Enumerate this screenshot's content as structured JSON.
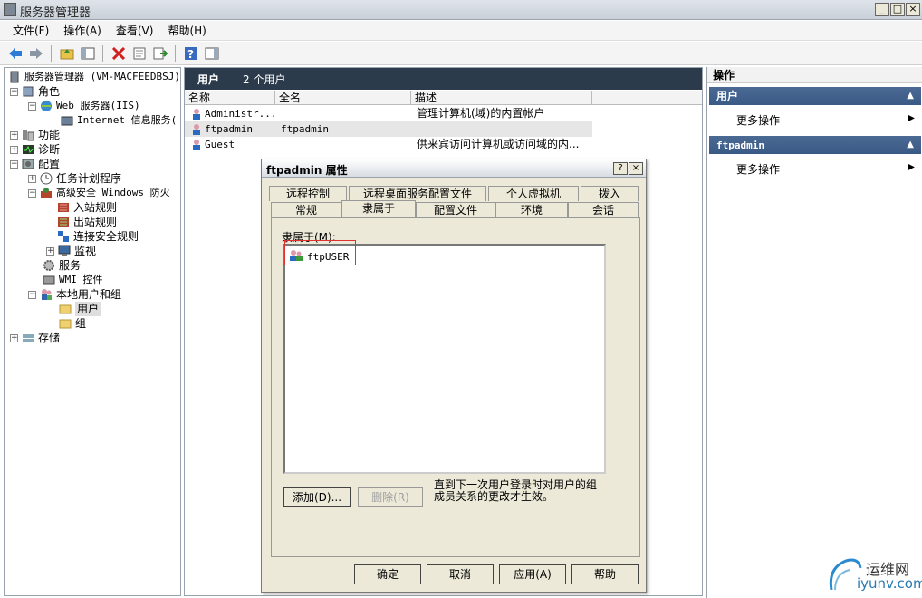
{
  "window": {
    "title": "服务器管理器"
  },
  "window_buttons": [
    "_",
    "□",
    "×"
  ],
  "menu": [
    "文件(F)",
    "操作(A)",
    "查看(V)",
    "帮助(H)"
  ],
  "tree": [
    {
      "label": "服务器管理器 (VM-MACFEEDBSJ)",
      "icon": "server-manager-icon"
    },
    {
      "label": "角色",
      "expander": "−",
      "icon": "roles-icon"
    },
    {
      "label": "Web 服务器(IIS)",
      "expander": "−",
      "icon": "web-server-icon"
    },
    {
      "label": "Internet 信息服务(",
      "icon": "iis-icon"
    },
    {
      "label": "功能",
      "expander": "+",
      "icon": "features-icon"
    },
    {
      "label": "诊断",
      "expander": "+",
      "icon": "diagnostics-icon"
    },
    {
      "label": "配置",
      "expander": "−",
      "icon": "configuration-icon"
    },
    {
      "label": "任务计划程序",
      "expander": "+",
      "icon": "task-scheduler-icon"
    },
    {
      "label": "高级安全 Windows 防火",
      "expander": "−",
      "icon": "firewall-icon"
    },
    {
      "label": "入站规则",
      "icon": "inbound-rules-icon"
    },
    {
      "label": "出站规则",
      "icon": "outbound-rules-icon"
    },
    {
      "label": "连接安全规则",
      "icon": "connection-rules-icon"
    },
    {
      "label": "监视",
      "expander": "+",
      "icon": "monitor-icon"
    },
    {
      "label": "服务",
      "icon": "services-icon"
    },
    {
      "label": "WMI 控件",
      "icon": "wmi-icon"
    },
    {
      "label": "本地用户和组",
      "expander": "−",
      "icon": "local-users-icon"
    },
    {
      "label": "用户",
      "icon": "folder-icon",
      "selected": true
    },
    {
      "label": "组",
      "icon": "folder-icon"
    },
    {
      "label": "存储",
      "expander": "+",
      "icon": "storage-icon"
    }
  ],
  "center": {
    "header_title": "用户",
    "header_count": "2 个用户",
    "columns": [
      "名称",
      "全名",
      "描述"
    ],
    "rows": [
      {
        "name": "Administr...",
        "fullname": "",
        "desc": "管理计算机(域)的内置帐户"
      },
      {
        "name": "ftpadmin",
        "fullname": "ftpadmin",
        "desc": ""
      },
      {
        "name": "Guest",
        "fullname": "",
        "desc": "供来宾访问计算机或访问域的内..."
      }
    ]
  },
  "actions": {
    "title": "操作",
    "section1": "用户",
    "section1_action": "更多操作",
    "section2": "ftpadmin",
    "section2_action": "更多操作"
  },
  "dialog": {
    "title": "ftpadmin 属性",
    "help_btn": "?",
    "close_btn": "×",
    "tabs_row1": [
      "远程控制",
      "远程桌面服务配置文件",
      "个人虚拟机",
      "拨入"
    ],
    "tabs_row2": [
      "常规",
      "隶属于",
      "配置文件",
      "环境",
      "会话"
    ],
    "member_label": "隶属于(M):",
    "members": [
      "ftpUSER"
    ],
    "add_btn": "添加(D)...",
    "remove_btn": "删除(R)",
    "note": "直到下一次用户登录时对用户的组成员关系的更改才生效。",
    "ok_btn": "确定",
    "cancel_btn": "取消",
    "apply_btn": "应用(A)",
    "help_label": "帮助"
  },
  "watermark": {
    "line1": "运维网",
    "line2": "iyunv.com"
  }
}
